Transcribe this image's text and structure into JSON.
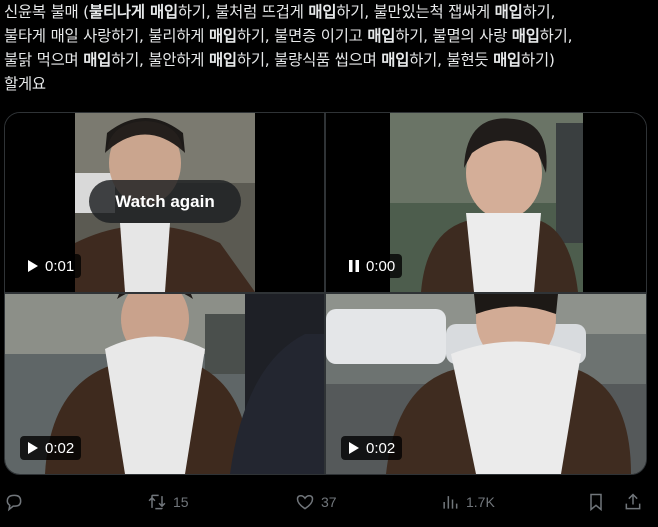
{
  "tweet": {
    "line1_a": "신윤복 불매 (",
    "line1_b": "불티나게 매입",
    "line1_c": "하기, 불처럼 뜨겁게 ",
    "line1_d": "매입",
    "line1_e": "하기, 불만있는척 잽싸게 ",
    "line1_f": "매입",
    "line1_g": "하기,",
    "line2_a": "불타게 매일 사랑하기, 불리하게 ",
    "line2_b": "매입",
    "line2_c": "하기, 불면증 이기고 ",
    "line2_d": "매입",
    "line2_e": "하기, 불멸의 사랑 ",
    "line2_f": "매입",
    "line2_g": "하기,",
    "line3_a": "불닭 먹으며 ",
    "line3_b": "매입",
    "line3_c": "하기, 불안하게 ",
    "line3_d": "매입",
    "line3_e": "하기, 불량식품 씹으며 ",
    "line3_f": "매입",
    "line3_g": "하기, 불현듯 ",
    "line3_h": "매입",
    "line3_i": "하기)",
    "line4": "할게요"
  },
  "media": {
    "watch_again_label": "Watch again",
    "videos": [
      {
        "time": "0:01",
        "state": "play"
      },
      {
        "time": "0:00",
        "state": "pause"
      },
      {
        "time": "0:02",
        "state": "play"
      },
      {
        "time": "0:02",
        "state": "play"
      }
    ]
  },
  "actions": {
    "replies": "",
    "reposts": "15",
    "likes": "37",
    "views": "1.7K"
  },
  "icons": {
    "reply": "reply-icon",
    "repost": "repost-icon",
    "like": "heart-icon",
    "views": "views-icon",
    "bookmark": "bookmark-icon",
    "share": "share-icon"
  }
}
